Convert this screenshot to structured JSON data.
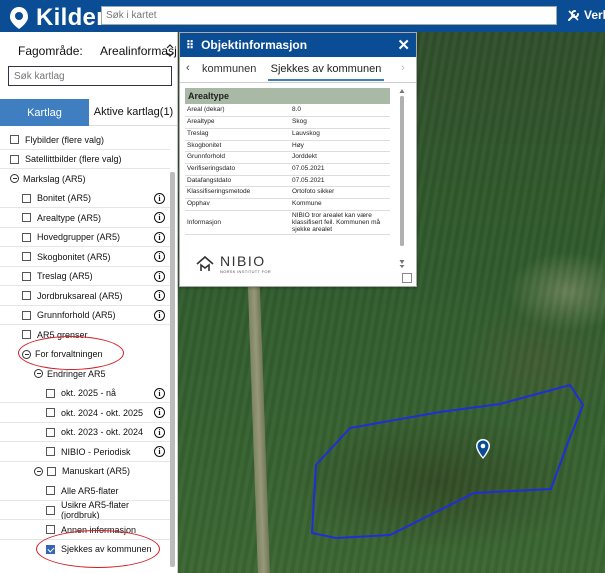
{
  "app": {
    "title": "Kilden",
    "search_placeholder": "Søk i kartet",
    "tools_label": "Verkt",
    "brand_color": "#0a4d94"
  },
  "left_panel": {
    "fagomrade_label": "Fagområde:",
    "fagomrade_value": "Arealinformasjon",
    "layer_search_placeholder": "Søk kartlag",
    "tabs": [
      {
        "label": "Kartlag",
        "active": true
      },
      {
        "label": "Aktive kartlag(1)",
        "active": false
      }
    ],
    "tree": [
      {
        "label": "Flybilder (flere valg)",
        "level": 0,
        "type": "checkbox",
        "checked": false,
        "info": false
      },
      {
        "label": "Satellittbilder (flere valg)",
        "level": 0,
        "type": "checkbox",
        "checked": false,
        "info": false
      },
      {
        "label": "Markslag (AR5)",
        "level": 0,
        "type": "toggle",
        "info": false
      },
      {
        "label": "Bonitet (AR5)",
        "level": 1,
        "type": "checkbox",
        "checked": false,
        "info": true
      },
      {
        "label": "Arealtype (AR5)",
        "level": 1,
        "type": "checkbox",
        "checked": false,
        "info": true
      },
      {
        "label": "Hovedgrupper (AR5)",
        "level": 1,
        "type": "checkbox",
        "checked": false,
        "info": true
      },
      {
        "label": "Skogbonitet (AR5)",
        "level": 1,
        "type": "checkbox",
        "checked": false,
        "info": true
      },
      {
        "label": "Treslag (AR5)",
        "level": 1,
        "type": "checkbox",
        "checked": false,
        "info": true
      },
      {
        "label": "Jordbruksareal (AR5)",
        "level": 1,
        "type": "checkbox",
        "checked": false,
        "info": true
      },
      {
        "label": "Grunnforhold (AR5)",
        "level": 1,
        "type": "checkbox",
        "checked": false,
        "info": true
      },
      {
        "label": "AR5 grenser",
        "level": 1,
        "type": "checkbox",
        "checked": false,
        "info": false
      },
      {
        "label": "For forvaltningen",
        "level": 1,
        "type": "toggle",
        "info": false
      },
      {
        "label": "Endringer AR5",
        "level": 2,
        "type": "toggle",
        "info": false
      },
      {
        "label": "okt. 2025 - nå",
        "level": 3,
        "type": "checkbox",
        "checked": false,
        "info": true
      },
      {
        "label": "okt. 2024 - okt. 2025",
        "level": 3,
        "type": "checkbox",
        "checked": false,
        "info": true
      },
      {
        "label": "okt. 2023 - okt. 2024",
        "level": 3,
        "type": "checkbox",
        "checked": false,
        "info": true
      },
      {
        "label": "NIBIO - Periodisk",
        "level": 3,
        "type": "checkbox",
        "checked": false,
        "info": true
      },
      {
        "label": "Manuskart (AR5)",
        "level": 2,
        "type": "toggle-checkbox",
        "checked": false,
        "info": false
      },
      {
        "label": "Alle AR5-flater",
        "level": 3,
        "type": "checkbox",
        "checked": false,
        "info": false
      },
      {
        "label": "Usikre AR5-flater (jordbruk)",
        "level": 3,
        "type": "checkbox",
        "checked": false,
        "info": false
      },
      {
        "label": "Annen informasjon",
        "level": 3,
        "type": "checkbox",
        "checked": false,
        "info": false
      },
      {
        "label": "Sjekkes av kommunen",
        "level": 3,
        "type": "checkbox",
        "checked": true,
        "info": false
      }
    ]
  },
  "popup": {
    "title": "Objektinformasjon",
    "nav_prev": "kommunen",
    "nav_current": "Sjekkes av kommunen",
    "section_title": "Arealtype",
    "rows": [
      {
        "k": "Areal (dekar)",
        "v": "8.0"
      },
      {
        "k": "Arealtype",
        "v": "Skog"
      },
      {
        "k": "Treslag",
        "v": "Lauvskog"
      },
      {
        "k": "Skogbonitet",
        "v": "Høy"
      },
      {
        "k": "Grunnforhold",
        "v": "Jorddekt"
      },
      {
        "k": "Verifiseringsdato",
        "v": "07.05.2021"
      },
      {
        "k": "Datafangstdato",
        "v": "07.05.2021"
      },
      {
        "k": "Klassifiseringsmetode",
        "v": "Ortofoto sikker"
      },
      {
        "k": "Opphav",
        "v": "Kommune"
      },
      {
        "k": "Informasjon",
        "v": "NIBIO tror arealet kan være klassifisert feil. Kommunen må sjekke arealet"
      }
    ],
    "logo_name": "NIBIO",
    "logo_sub": "NORSK INSTITUTT FOR"
  },
  "colors": {
    "annotation_red": "#d21d24",
    "polygon_blue": "#1f2ed8",
    "tab_blue": "#3f7ec1"
  }
}
